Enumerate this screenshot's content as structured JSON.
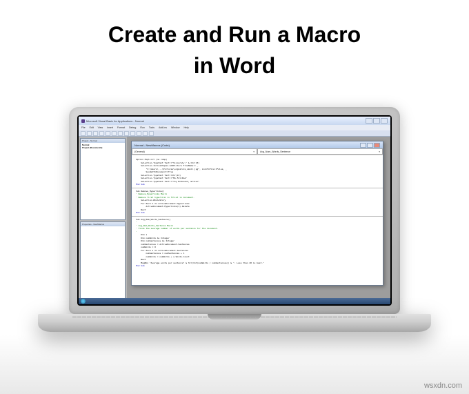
{
  "heading": {
    "line1": "Create and Run a Macro",
    "line2": "in Word"
  },
  "watermark": "wsxdn.com",
  "vba": {
    "title": "Microsoft Visual Basic for Applications - Normal",
    "menu": [
      "File",
      "Edit",
      "View",
      "Insert",
      "Format",
      "Debug",
      "Run",
      "Tools",
      "Add-Ins",
      "Window",
      "Help"
    ],
    "project_panel_title": "Project - Normal",
    "tree": [
      "Normal",
      "Project (Document1)"
    ],
    "props_panel_title": "Properties - NewMacros",
    "code_window_title": "Normal - NewMacros (Code)",
    "object_dropdown": "(General)",
    "proc_dropdown": "Avg_Num_Words_Sentence",
    "code_lines": [
      {
        "t": "Option Explicit (no comp)",
        "c": "black"
      },
      {
        "t": "    Selection.TypeText Text:=\"Sincerely,\" & Chr(13)",
        "c": "black"
      },
      {
        "t": "    Selection.InlineShapes.AddPicture FileName:= _",
        "c": "black"
      },
      {
        "t": "        \"C:\\Users\\...\\Pictures\\signature_small.jpg\", LinkToFile:=False, _",
        "c": "black"
      },
      {
        "t": "        SaveWithDocument:=True",
        "c": "black"
      },
      {
        "t": "    Selection.TypeText Text:=Chr(13)",
        "c": "black"
      },
      {
        "t": "    Selection.TypeText Text:=\"Ms.FullDoe\"",
        "c": "black"
      },
      {
        "t": "    Selection.TypeText Text:=\"Toy McDonald, Writer\"",
        "c": "black"
      },
      {
        "t": "End Sub",
        "c": "blue"
      },
      {
        "t": "Sub Remove_Hyperlinks()",
        "c": "black"
      },
      {
        "t": "",
        "c": "black"
      },
      {
        "t": "' Remove_Hyperlinks Macro",
        "c": "green"
      },
      {
        "t": "' Remove first hyperlink in fllist in document.",
        "c": "green"
      },
      {
        "t": "    Selection.WholeStory",
        "c": "black"
      },
      {
        "t": "    For Each h In ActiveDocument.Hyperlinks",
        "c": "black"
      },
      {
        "t": "        ActiveDocument.Hyperlinks(1).Delete",
        "c": "black"
      },
      {
        "t": "    Next",
        "c": "black"
      },
      {
        "t": "End Sub",
        "c": "blue"
      },
      {
        "t": "Sub Avg_Num_Words_Sentence()",
        "c": "black"
      },
      {
        "t": "'",
        "c": "green"
      },
      {
        "t": "' Avg_Num_Words_Sentence Macro",
        "c": "green"
      },
      {
        "t": "' Finds the average number of words per sentence for the document.",
        "c": "green"
      },
      {
        "t": "'",
        "c": "green"
      },
      {
        "t": "    Dim s",
        "c": "black"
      },
      {
        "t": "    Dim numWords As Integer",
        "c": "black"
      },
      {
        "t": "    Dim numSentences As Integer",
        "c": "black"
      },
      {
        "t": "    numSentences = ActiveDocument.Sentences",
        "c": "black"
      },
      {
        "t": "    numWords = 0",
        "c": "black"
      },
      {
        "t": "    For Each s In ActiveDocument.Sentences",
        "c": "black"
      },
      {
        "t": "        numSentences = numSentences + 1",
        "c": "black"
      },
      {
        "t": "        numWords = numWords + s.Words.Count",
        "c": "black"
      },
      {
        "t": "    Next",
        "c": "black"
      },
      {
        "t": "    MsgBox \"Average words per sentence\" & Str(Int(numWords / numSentences)) & \". Less than 20 is best.\"",
        "c": "black"
      },
      {
        "t": "End Sub",
        "c": "blue"
      }
    ]
  }
}
